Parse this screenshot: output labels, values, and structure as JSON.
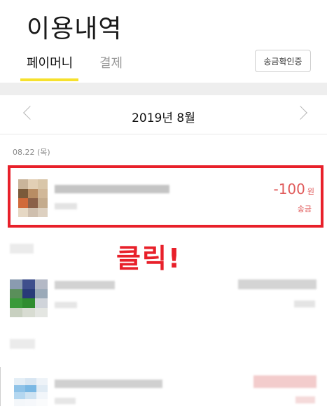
{
  "header": {
    "title": "이용내역"
  },
  "tabs": [
    {
      "label": "페이머니",
      "active": true
    },
    {
      "label": "결제",
      "active": false
    }
  ],
  "toolbar": {
    "transfer_confirm_label": "송금확인증"
  },
  "month_nav": {
    "label": "2019년 8월"
  },
  "date_groups": [
    {
      "date": "08.22 (목)"
    }
  ],
  "transactions": [
    {
      "amount": "-100",
      "unit": "원",
      "type": "송금"
    }
  ],
  "annotation": {
    "text": "클릭!"
  },
  "colors": {
    "accent_yellow": "#f6e12d",
    "highlight_red": "#e8202a",
    "amount_red": "#e05a5a"
  }
}
